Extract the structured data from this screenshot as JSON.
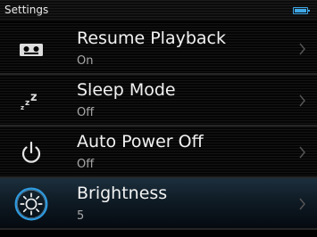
{
  "statusbar": {
    "title": "Settings",
    "battery_icon": "battery-icon"
  },
  "menu": {
    "items": [
      {
        "label": "Resume Playback",
        "value": "On",
        "icon": "resume-playback-icon"
      },
      {
        "label": "Sleep Mode",
        "value": "Off",
        "icon": "sleep-icon"
      },
      {
        "label": "Auto Power Off",
        "value": "Off",
        "icon": "power-icon"
      },
      {
        "label": "Brightness",
        "value": "5",
        "icon": "brightness-icon"
      }
    ],
    "selected_index": 3
  },
  "colors": {
    "accent": "#3ea7e6",
    "text": "#ffffff",
    "subtext": "#a8a8a8",
    "background": "#000000"
  }
}
